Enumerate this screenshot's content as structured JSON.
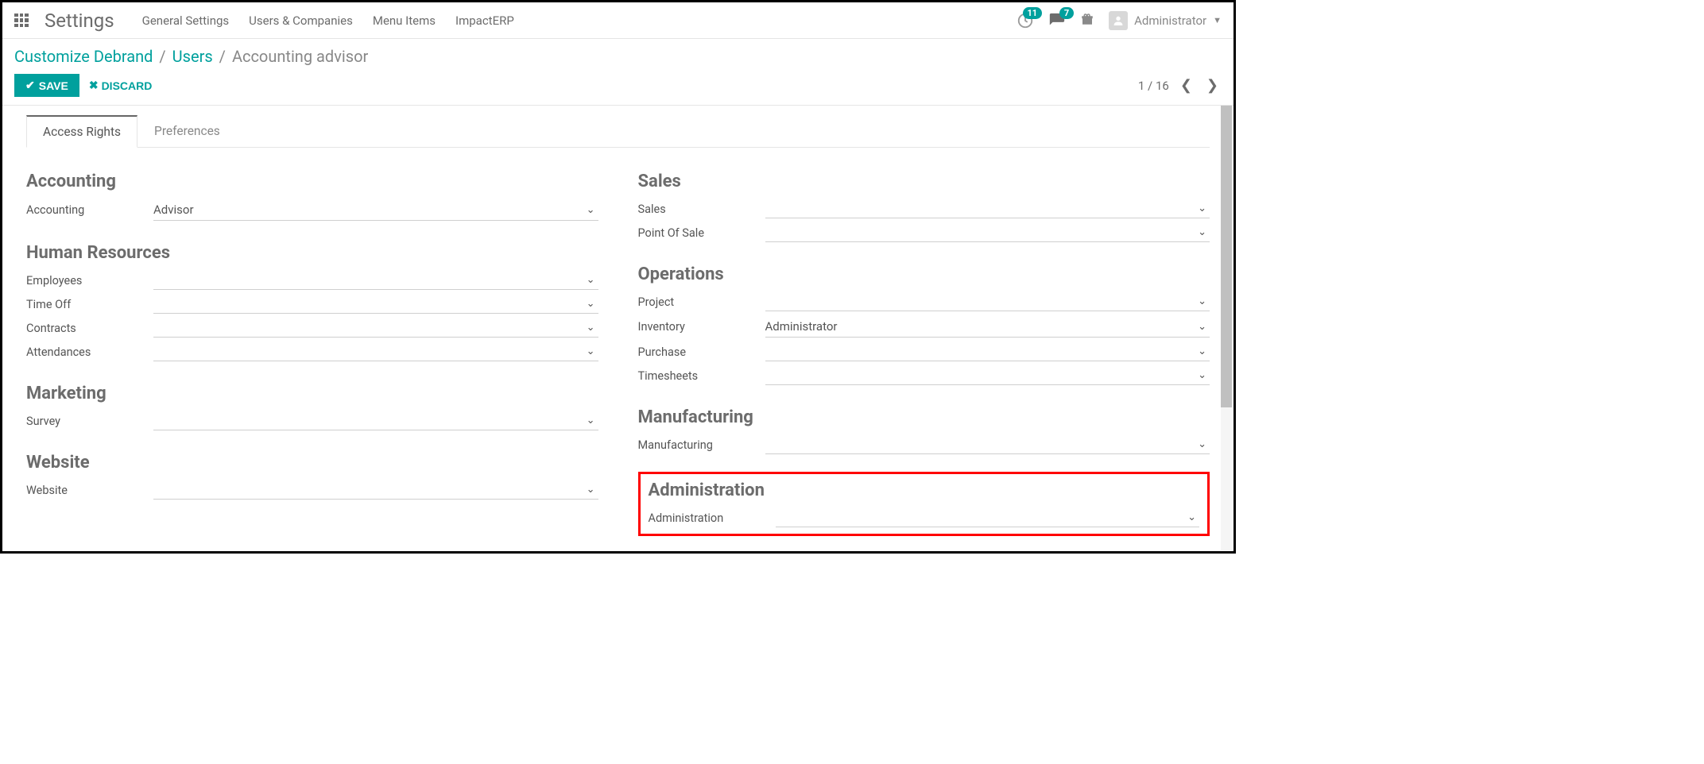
{
  "header": {
    "brand": "Settings",
    "nav": [
      "General Settings",
      "Users & Companies",
      "Menu Items",
      "ImpactERP"
    ],
    "clock_badge": "11",
    "chat_badge": "7",
    "user": "Administrator"
  },
  "breadcrumbs": {
    "items": [
      "Customize Debrand",
      "Users"
    ],
    "current": "Accounting advisor"
  },
  "actions": {
    "save": "SAVE",
    "discard": "DISCARD"
  },
  "pager": {
    "text": "1 / 16"
  },
  "tabs": {
    "active": "Access Rights",
    "other": "Preferences"
  },
  "left_groups": [
    {
      "title": "Accounting",
      "fields": [
        {
          "label": "Accounting",
          "value": "Advisor"
        }
      ]
    },
    {
      "title": "Human Resources",
      "fields": [
        {
          "label": "Employees",
          "value": ""
        },
        {
          "label": "Time Off",
          "value": ""
        },
        {
          "label": "Contracts",
          "value": ""
        },
        {
          "label": "Attendances",
          "value": ""
        }
      ]
    },
    {
      "title": "Marketing",
      "fields": [
        {
          "label": "Survey",
          "value": ""
        }
      ]
    },
    {
      "title": "Website",
      "fields": [
        {
          "label": "Website",
          "value": ""
        }
      ]
    }
  ],
  "right_groups": [
    {
      "title": "Sales",
      "fields": [
        {
          "label": "Sales",
          "value": ""
        },
        {
          "label": "Point Of Sale",
          "value": ""
        }
      ]
    },
    {
      "title": "Operations",
      "fields": [
        {
          "label": "Project",
          "value": ""
        },
        {
          "label": "Inventory",
          "value": "Administrator"
        },
        {
          "label": "Purchase",
          "value": ""
        },
        {
          "label": "Timesheets",
          "value": ""
        }
      ]
    },
    {
      "title": "Manufacturing",
      "fields": [
        {
          "label": "Manufacturing",
          "value": ""
        }
      ]
    },
    {
      "title": "Administration",
      "highlight": true,
      "fields": [
        {
          "label": "Administration",
          "value": ""
        }
      ]
    }
  ]
}
